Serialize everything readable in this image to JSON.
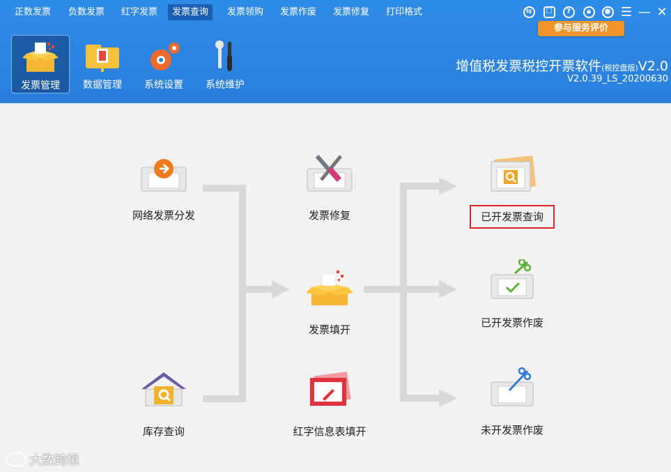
{
  "menubar": {
    "items": [
      "正数发票",
      "负数发票",
      "红字发票",
      "发票查询",
      "发票领购",
      "发票作废",
      "发票修复",
      "打印格式"
    ],
    "active_index": 3
  },
  "window_controls": {
    "icons": [
      "switch-icon",
      "phone-icon",
      "help-icon",
      "lock-icon",
      "user-icon",
      "menu-icon",
      "minimize-icon",
      "close-icon"
    ]
  },
  "eval_button": {
    "label": "参与服务评价"
  },
  "toolbar": {
    "items": [
      {
        "label": "发票管理",
        "icon": "invoice-box-icon"
      },
      {
        "label": "数据管理",
        "icon": "folder-icon"
      },
      {
        "label": "系统设置",
        "icon": "gears-icon"
      },
      {
        "label": "系统维护",
        "icon": "tools-icon"
      }
    ],
    "active_index": 0
  },
  "app": {
    "title": "增值税发票税控开票软件",
    "edition": "(税控盘版)",
    "version_short": "V2.0",
    "version_full": "V2.0.39_LS_20200630"
  },
  "flow": {
    "nodes": {
      "network_dist": "网络发票分发",
      "stock_query": "库存查询",
      "invoice_repair": "发票修复",
      "invoice_fill": "发票填开",
      "red_info_fill": "红字信息表填开",
      "issued_query": "已开发票查询",
      "issued_void": "已开发票作废",
      "unissued_void": "未开发票作废"
    },
    "highlighted": "issued_query"
  },
  "watermark": {
    "text": "大数跨境"
  },
  "colors": {
    "header": "#2a7fdc",
    "active_menu": "#1a5fb4",
    "accent_orange": "#f0932b",
    "highlight_red": "#d9252a",
    "flow_gray": "#d8d8d8"
  }
}
